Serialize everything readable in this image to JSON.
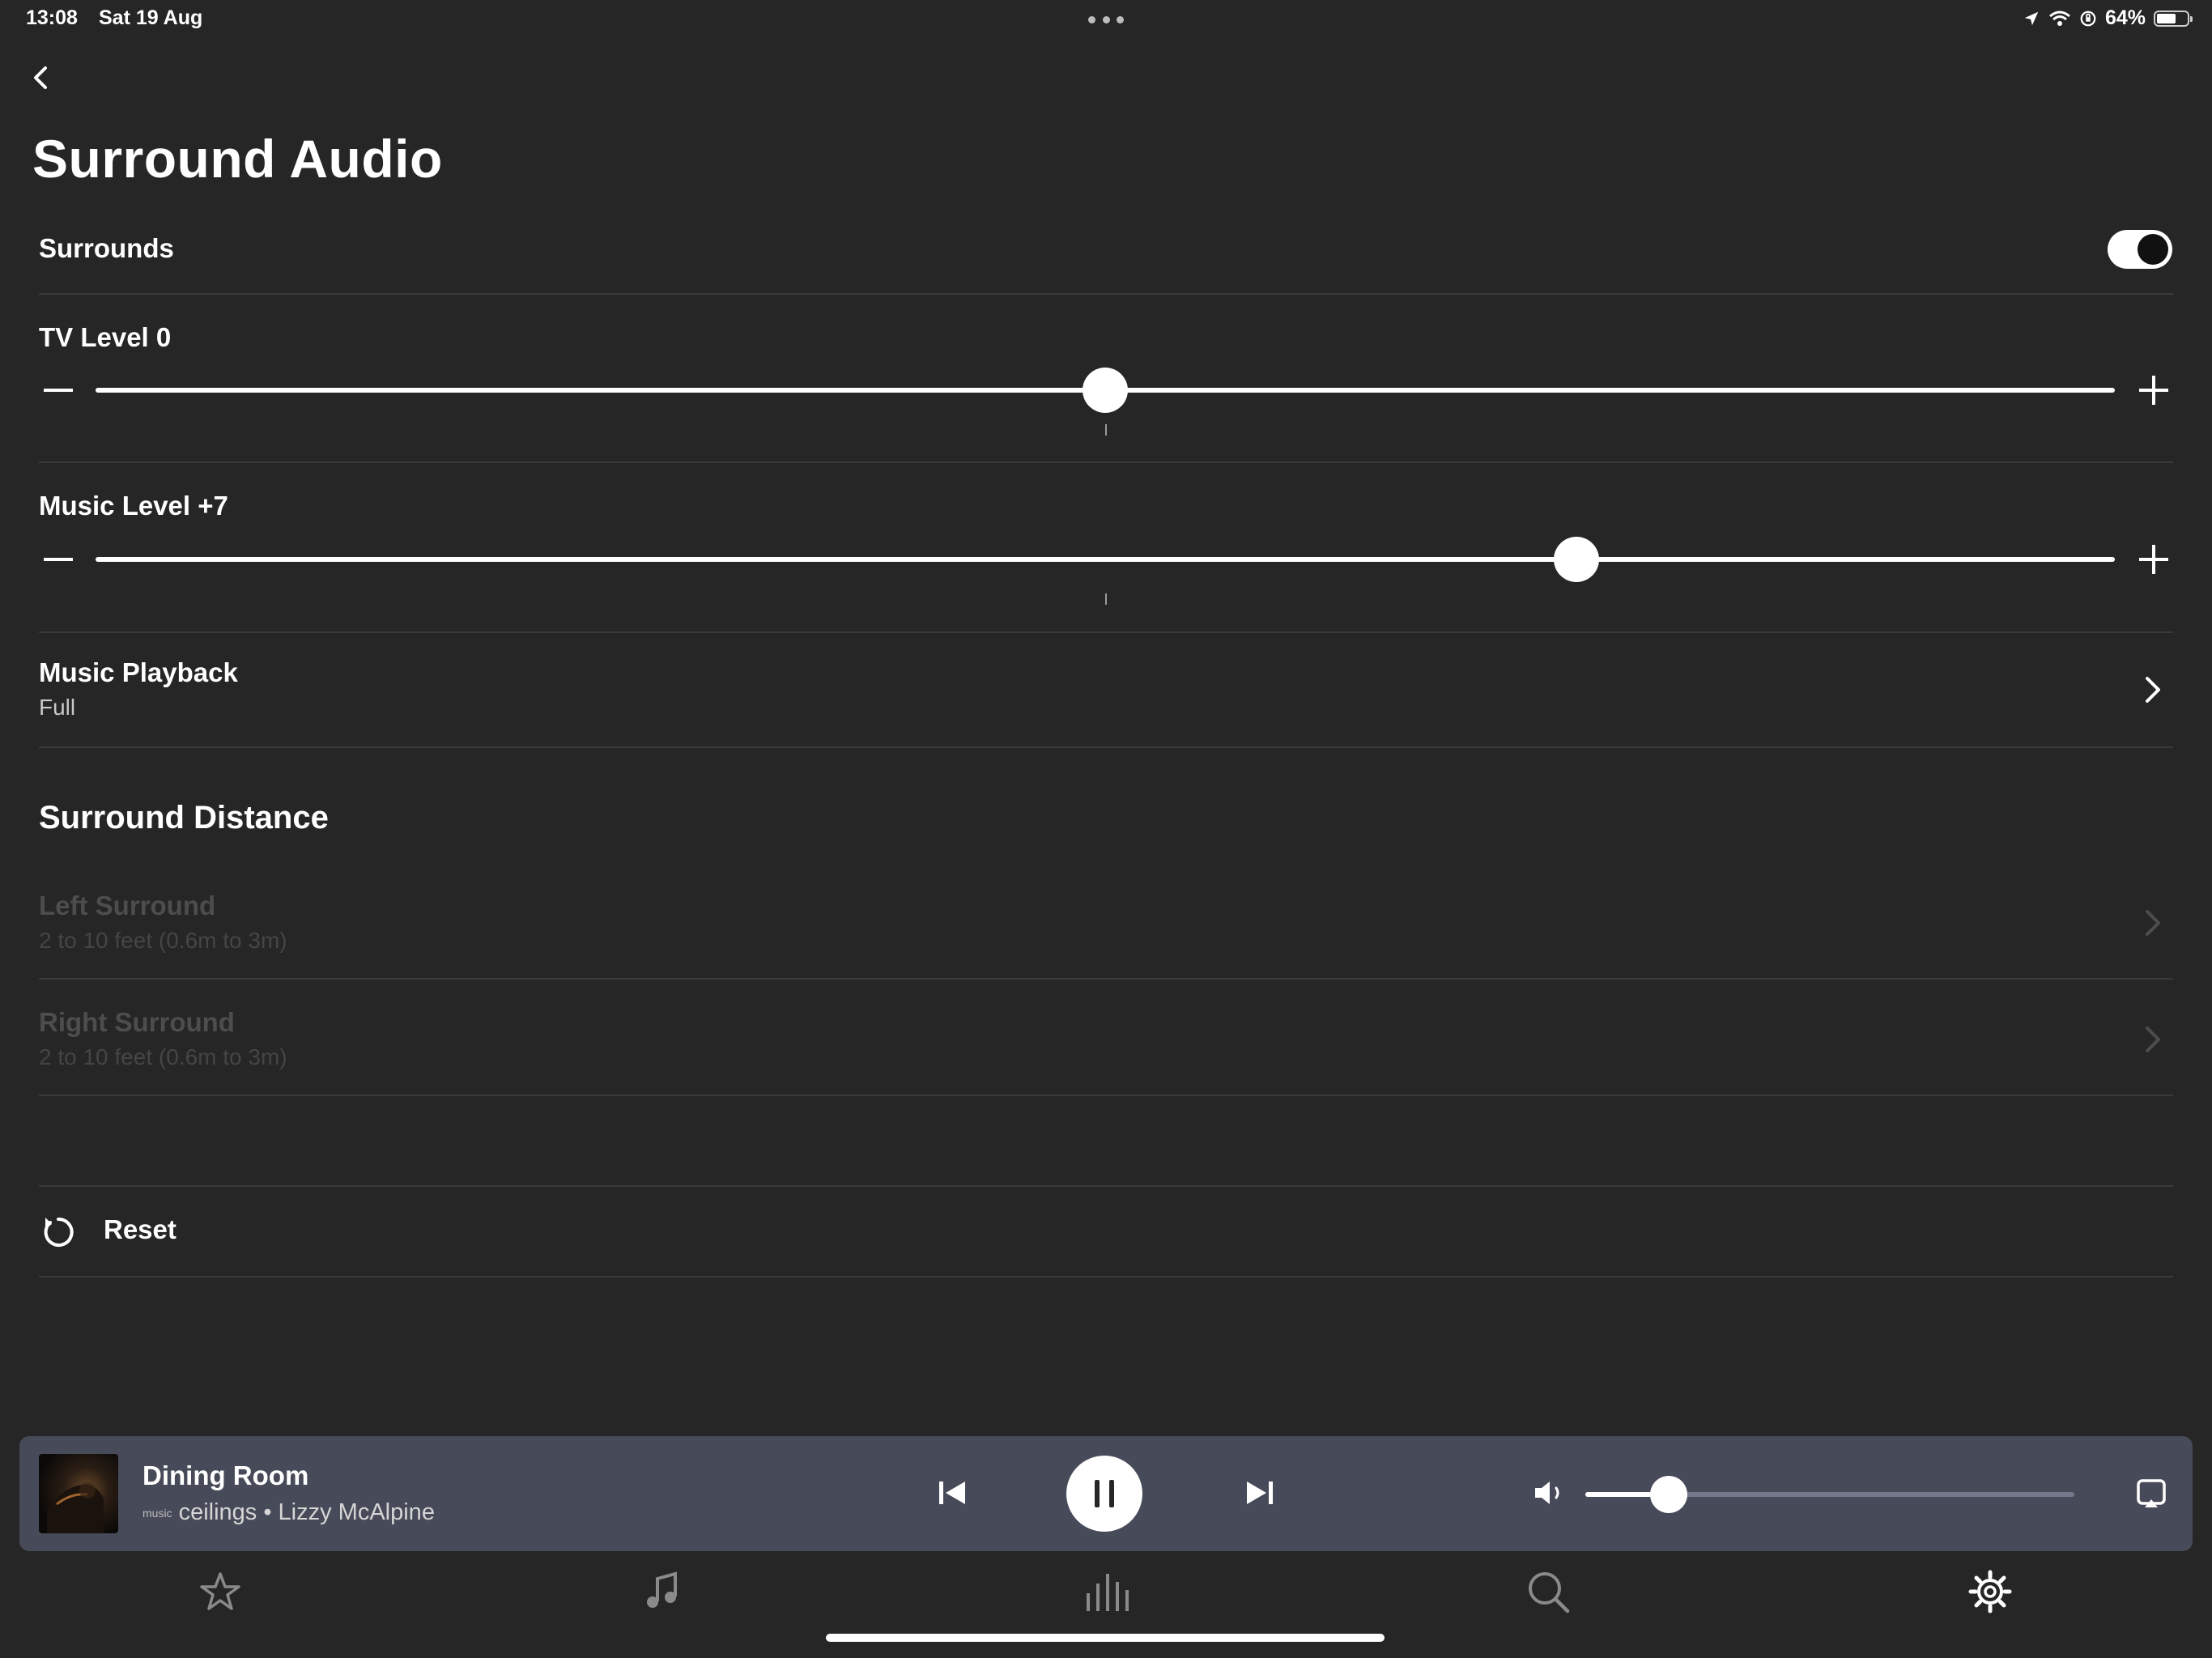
{
  "status_bar": {
    "time": "13:08",
    "date": "Sat 19 Aug",
    "battery_text": "64%",
    "battery_level": 0.64
  },
  "page": {
    "title": "Surround Audio"
  },
  "surrounds": {
    "label": "Surrounds",
    "enabled": true
  },
  "tv_level": {
    "label": "TV Level 0",
    "value": 0,
    "min": -15,
    "max": 15
  },
  "music_level": {
    "label": "Music Level +7",
    "value": 7,
    "min": -15,
    "max": 15
  },
  "music_playback": {
    "label": "Music Playback",
    "value": "Full"
  },
  "surround_distance": {
    "title": "Surround Distance",
    "left": {
      "label": "Left Surround",
      "value": "2 to 10 feet (0.6m to 3m)"
    },
    "right": {
      "label": "Right Surround",
      "value": "2 to 10 feet (0.6m to 3m)"
    }
  },
  "reset": {
    "label": "Reset"
  },
  "now_playing": {
    "room": "Dining Room",
    "service_logo": "music",
    "track_line": "ceilings • Lizzy McAlpine",
    "volume": 0.17
  },
  "tabs": [
    {
      "name": "favorites",
      "icon": "star-icon"
    },
    {
      "name": "music",
      "icon": "music-note-icon"
    },
    {
      "name": "rooms",
      "icon": "bars-icon"
    },
    {
      "name": "search",
      "icon": "search-icon"
    },
    {
      "name": "settings",
      "icon": "gear-icon",
      "active": true
    }
  ],
  "colors": {
    "background": "#262626",
    "now_playing_bar": "#474a59",
    "disabled_text": "#4d4d4d"
  }
}
